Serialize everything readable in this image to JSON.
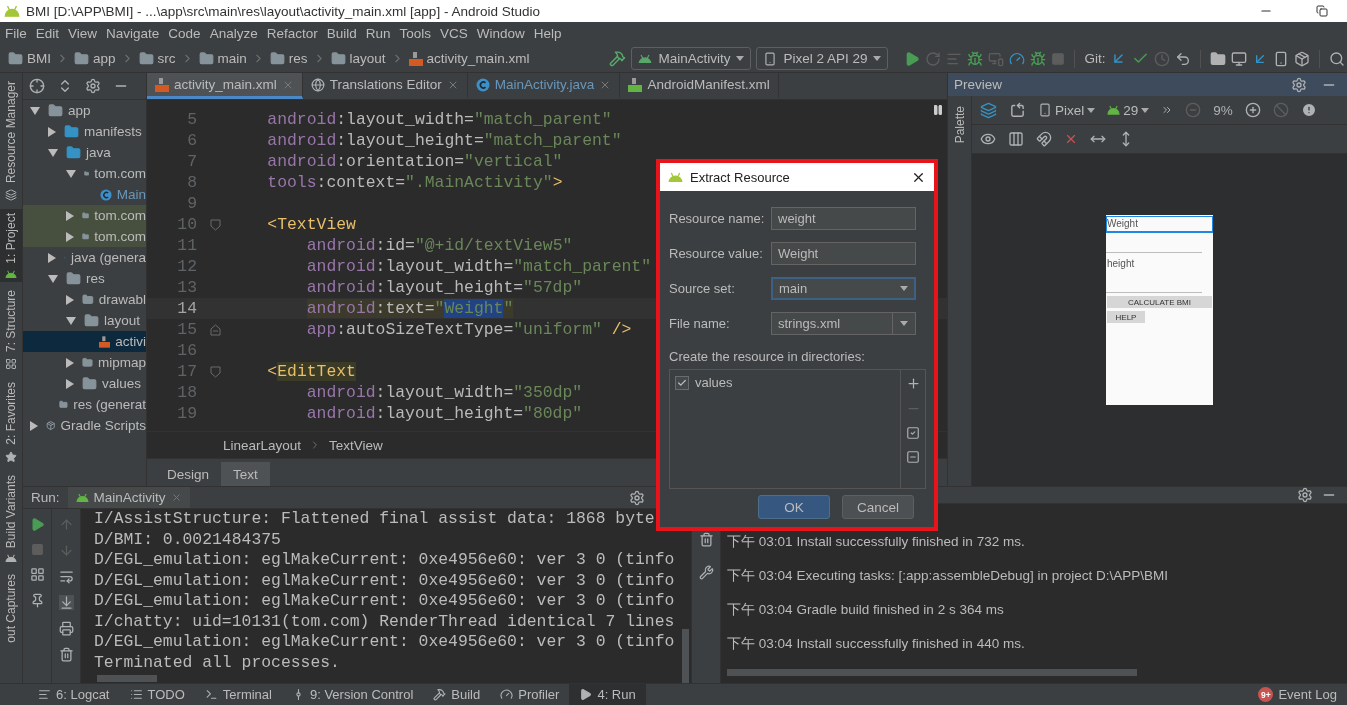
{
  "window": {
    "title": "BMI [D:\\APP\\BMI] - ...\\app\\src\\main\\res\\layout\\activity_main.xml [app] - Android Studio"
  },
  "menu": [
    "File",
    "Edit",
    "View",
    "Navigate",
    "Code",
    "Analyze",
    "Refactor",
    "Build",
    "Run",
    "Tools",
    "VCS",
    "Window",
    "Help"
  ],
  "breadcrumb": [
    {
      "label": "BMI",
      "kind": "project"
    },
    {
      "label": "app",
      "kind": "module"
    },
    {
      "label": "src",
      "kind": "folder"
    },
    {
      "label": "main",
      "kind": "folder"
    },
    {
      "label": "res",
      "kind": "res"
    },
    {
      "label": "layout",
      "kind": "folder"
    },
    {
      "label": "activity_main.xml",
      "kind": "layout-file"
    }
  ],
  "toolbar": {
    "run_config": "MainActivity",
    "device": "Pixel 2 API 29",
    "vcs_label": "Git:"
  },
  "side_tabs": [
    {
      "label": "Resource Manager",
      "selected": false,
      "kind": "resources"
    },
    {
      "label": "1: Project",
      "selected": true,
      "kind": "project"
    },
    {
      "label": "7: Structure",
      "selected": false,
      "kind": "structure"
    },
    {
      "label": "2: Favorites",
      "selected": false,
      "kind": "favorites"
    },
    {
      "label": "Build Variants",
      "selected": false,
      "kind": "variants"
    },
    {
      "label": "out Captures",
      "selected": false,
      "kind": "captures"
    }
  ],
  "project_tree": [
    {
      "label": "app",
      "kind": "module",
      "expanded": true,
      "selected": false,
      "tinted": false,
      "children": [
        {
          "label": "manifests",
          "kind": "source",
          "expanded": false,
          "selected": false,
          "tinted": false
        },
        {
          "label": "java",
          "kind": "source",
          "expanded": true,
          "selected": false,
          "tinted": false,
          "children": [
            {
              "label": "tom.com",
              "kind": "package",
              "expanded": true,
              "selected": false,
              "tinted": false,
              "children": [
                {
                  "label": "Main",
                  "kind": "class",
                  "selected": false,
                  "tinted": false
                }
              ]
            },
            {
              "label": "tom.com",
              "kind": "package",
              "expanded": false,
              "selected": false,
              "tinted": true
            },
            {
              "label": "tom.com",
              "kind": "package",
              "expanded": false,
              "selected": false,
              "tinted": true
            }
          ]
        },
        {
          "label": "java (genera",
          "kind": "generated",
          "expanded": false,
          "selected": false,
          "tinted": false
        },
        {
          "label": "res",
          "kind": "res",
          "expanded": true,
          "selected": false,
          "tinted": false,
          "children": [
            {
              "label": "drawabl",
              "kind": "package",
              "expanded": false,
              "selected": false,
              "tinted": false
            },
            {
              "label": "layout",
              "kind": "package",
              "expanded": true,
              "selected": false,
              "tinted": false,
              "children": [
                {
                  "label": "activi",
                  "kind": "layout-file",
                  "selected": true,
                  "tinted": false
                }
              ]
            },
            {
              "label": "mipmap",
              "kind": "package",
              "expanded": false,
              "selected": false,
              "tinted": false
            },
            {
              "label": "values",
              "kind": "package",
              "expanded": false,
              "selected": false,
              "tinted": false
            }
          ]
        },
        {
          "label": "res (generat",
          "kind": "res",
          "selected": false,
          "tinted": false
        }
      ]
    },
    {
      "label": "Gradle Scripts",
      "kind": "gradle",
      "expanded": false,
      "selected": false,
      "tinted": false
    }
  ],
  "editor_tabs": [
    {
      "label": "activity_main.xml",
      "kind": "layout-file",
      "selected": true,
      "closable": true
    },
    {
      "label": "Translations Editor",
      "kind": "globe",
      "selected": false,
      "closable": true
    },
    {
      "label": "MainActivity.java",
      "kind": "class",
      "selected": false,
      "closable": true
    },
    {
      "label": "AndroidManifest.xml",
      "kind": "manifest",
      "selected": false,
      "closable": false
    }
  ],
  "editor": {
    "lines": [
      {
        "number": "5",
        "kind": "plain",
        "current": false,
        "tokens": [
          {
            "text": "    android",
            "kind": "ns"
          },
          {
            "text": ":layout_width=",
            "kind": "attr"
          },
          {
            "text": "\"match_parent\"",
            "kind": "str"
          }
        ]
      },
      {
        "number": "6",
        "kind": "plain",
        "current": false,
        "tokens": [
          {
            "text": "    android",
            "kind": "ns"
          },
          {
            "text": ":layout_height=",
            "kind": "attr"
          },
          {
            "text": "\"match_parent\"",
            "kind": "str"
          }
        ]
      },
      {
        "number": "7",
        "kind": "plain",
        "current": false,
        "tokens": [
          {
            "text": "    android",
            "kind": "ns"
          },
          {
            "text": ":orientation=",
            "kind": "attr"
          },
          {
            "text": "\"vertical\"",
            "kind": "str"
          }
        ]
      },
      {
        "number": "8",
        "kind": "plain",
        "current": false,
        "tokens": [
          {
            "text": "    tools",
            "kind": "ns"
          },
          {
            "text": ":context=",
            "kind": "attr"
          },
          {
            "text": "\".MainActivity\"",
            "kind": "str"
          },
          {
            "text": ">",
            "kind": "tag"
          }
        ]
      },
      {
        "number": "9",
        "kind": "plain",
        "current": false
      },
      {
        "number": "10",
        "kind": "fold-start",
        "current": false,
        "tokens": [
          {
            "text": "    <TextView",
            "kind": "tag"
          }
        ]
      },
      {
        "number": "11",
        "kind": "plain",
        "current": false,
        "tokens": [
          {
            "text": "        android",
            "kind": "ns"
          },
          {
            "text": ":id=",
            "kind": "attr"
          },
          {
            "text": "\"@+id/textView5\"",
            "kind": "str"
          }
        ]
      },
      {
        "number": "12",
        "kind": "plain",
        "current": false,
        "tokens": [
          {
            "text": "        android",
            "kind": "ns"
          },
          {
            "text": ":layout_width=",
            "kind": "attr"
          },
          {
            "text": "\"match_parent\"",
            "kind": "str"
          }
        ]
      },
      {
        "number": "13",
        "kind": "plain",
        "current": false,
        "tokens": [
          {
            "text": "        android",
            "kind": "ns"
          },
          {
            "text": ":layout_height=",
            "kind": "attr"
          },
          {
            "text": "\"57dp\"",
            "kind": "str"
          }
        ]
      },
      {
        "number": "14",
        "kind": "plain",
        "current": true,
        "tokens": [
          {
            "text": "        android",
            "kind": "ns-hl"
          },
          {
            "text": ":text=",
            "kind": "attr-hl"
          },
          {
            "text": "\"",
            "kind": "str-hl"
          },
          {
            "text": "Weight",
            "kind": "sel"
          },
          {
            "text": "\"",
            "kind": "str-hl"
          }
        ]
      },
      {
        "number": "15",
        "kind": "fold-end",
        "current": false,
        "tokens": [
          {
            "text": "        app",
            "kind": "ns"
          },
          {
            "text": ":autoSizeTextType=",
            "kind": "attr"
          },
          {
            "text": "\"uniform\"",
            "kind": "str"
          },
          {
            "text": " />",
            "kind": "tag"
          }
        ]
      },
      {
        "number": "16",
        "kind": "plain",
        "current": false
      },
      {
        "number": "17",
        "kind": "fold-start",
        "current": false,
        "tokens": [
          {
            "text": "    <",
            "kind": "tag"
          },
          {
            "text": "EditText",
            "kind": "tag-hl"
          }
        ]
      },
      {
        "number": "18",
        "kind": "plain",
        "current": false,
        "tokens": [
          {
            "text": "        android",
            "kind": "ns"
          },
          {
            "text": ":layout_width=",
            "kind": "attr"
          },
          {
            "text": "\"350dp\"",
            "kind": "str"
          }
        ]
      },
      {
        "number": "19",
        "kind": "plain",
        "current": false,
        "tokens": [
          {
            "text": "        android",
            "kind": "ns"
          },
          {
            "text": ":layout_height=",
            "kind": "attr"
          },
          {
            "text": "\"80dp\"",
            "kind": "str"
          }
        ]
      }
    ],
    "breadcrumb": [
      "LinearLayout",
      "TextView"
    ],
    "mode_tabs": [
      {
        "label": "Design",
        "selected": false
      },
      {
        "label": "Text",
        "selected": true
      }
    ]
  },
  "preview": {
    "title": "Preview",
    "palette_label": "Palette",
    "device": "Pixel",
    "api": "29",
    "zoom": "9%",
    "phone": [
      {
        "kind": "text",
        "label": "Weight",
        "selected": true
      },
      {
        "kind": "input",
        "selected": false
      },
      {
        "kind": "text",
        "label": "height",
        "selected": false
      },
      {
        "kind": "input",
        "selected": false
      },
      {
        "kind": "wide-button",
        "label": "CALCULATE BMI",
        "selected": false
      },
      {
        "kind": "button",
        "label": "HELP",
        "selected": false
      }
    ]
  },
  "dialog": {
    "title": "Extract Resource",
    "fields": [
      {
        "label": "Resource name:",
        "value": "weight",
        "kind": "text",
        "focused": false
      },
      {
        "label": "Resource value:",
        "value": "Weight",
        "kind": "text",
        "focused": false
      },
      {
        "label": "Source set:",
        "value": "main",
        "kind": "select",
        "focused": true
      },
      {
        "label": "File name:",
        "value": "strings.xml",
        "kind": "combo",
        "focused": false
      }
    ],
    "directories_label": "Create the resource in directories:",
    "directories": [
      {
        "label": "values",
        "checked": true
      }
    ],
    "buttons": [
      {
        "label": "OK",
        "primary": true
      },
      {
        "label": "Cancel",
        "primary": false
      }
    ]
  },
  "run": {
    "label": "Run:",
    "tab": "MainActivity",
    "lines": [
      "I/AssistStructure: Flattened final assist data: 1868 byte",
      "D/BMI: 0.0021484375",
      "D/EGL_emulation: eglMakeCurrent: 0xe4956e60: ver 3 0 (tinfo",
      "D/EGL_emulation: eglMakeCurrent: 0xe4956e60: ver 3 0 (tinfo",
      "D/EGL_emulation: eglMakeCurrent: 0xe4956e60: ver 3 0 (tinfo",
      "I/chatty: uid=10131(tom.com) RenderThread identical 7 lines",
      "D/EGL_emulation: eglMakeCurrent: 0xe4956e60: ver 3 0 (tinfo",
      "Terminated all processes."
    ]
  },
  "event_log": [
    {
      "time": "下午 03:01",
      "message": "Install successfully finished in 732 ms."
    },
    {
      "time": "下午 03:04",
      "message": "Executing tasks: [:app:assembleDebug] in project D:\\APP\\BMI"
    },
    {
      "time": "下午 03:04",
      "message": "Gradle build finished in 2 s 364 ms"
    },
    {
      "time": "下午 03:04",
      "message": "Install successfully finished in 440 ms."
    }
  ],
  "status_bar": {
    "tools": [
      {
        "label": "6: Logcat",
        "kind": "logcat",
        "selected": false
      },
      {
        "label": "TODO",
        "kind": "todo",
        "selected": false
      },
      {
        "label": "Terminal",
        "kind": "terminal",
        "selected": false
      },
      {
        "label": "9: Version Control",
        "kind": "vcs",
        "selected": false
      },
      {
        "label": "Build",
        "kind": "build",
        "selected": false
      },
      {
        "label": "Profiler",
        "kind": "profiler",
        "selected": false
      },
      {
        "label": "4: Run",
        "kind": "run",
        "selected": true
      }
    ],
    "event_log": {
      "label": "Event Log",
      "badge": "9+"
    }
  }
}
